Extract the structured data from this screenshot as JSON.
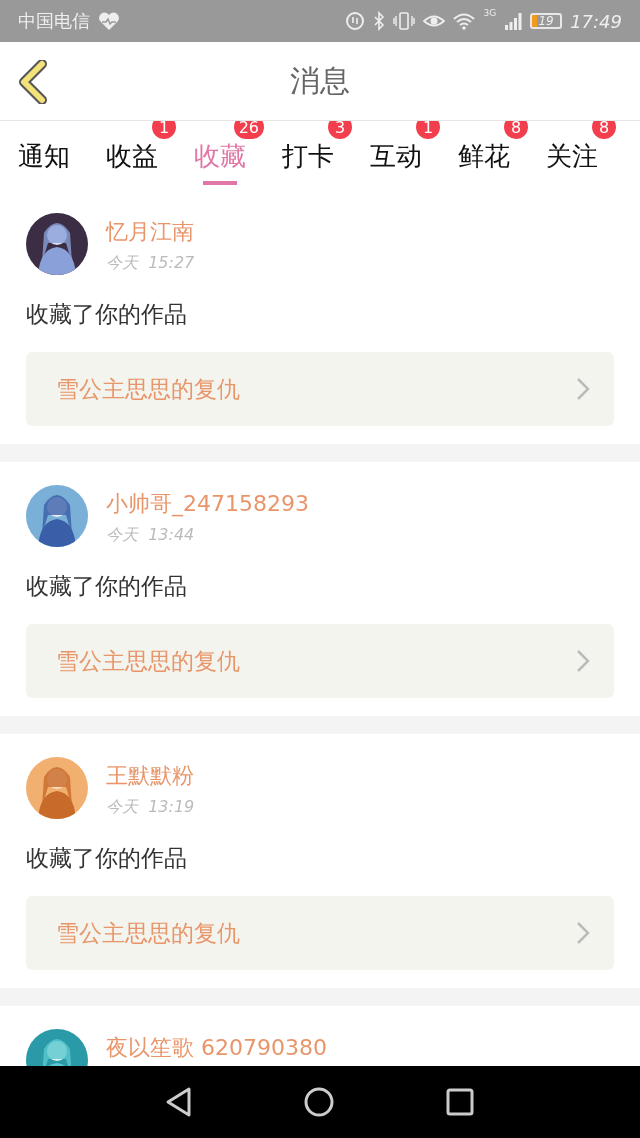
{
  "status_bar": {
    "carrier": "中国电信",
    "network": "3G",
    "battery": "19",
    "time": "17:49"
  },
  "header": {
    "title": "消息"
  },
  "tabs": [
    {
      "label": "通知",
      "selected": false
    },
    {
      "label": "收益",
      "badge": "1",
      "selected": false
    },
    {
      "label": "收藏",
      "badge": "26",
      "selected": true
    },
    {
      "label": "打卡",
      "badge": "3",
      "selected": false
    },
    {
      "label": "互动",
      "badge": "1",
      "selected": false
    },
    {
      "label": "鲜花",
      "badge": "8",
      "selected": false
    },
    {
      "label": "关注",
      "badge": "8",
      "selected": false
    }
  ],
  "messages": [
    {
      "user": "忆月江南",
      "time": "今天  15:27",
      "action": "收藏了你的作品",
      "work": "雪公主思思的复仇"
    },
    {
      "user": "小帅哥_247158293",
      "time": "今天  13:44",
      "action": "收藏了你的作品",
      "work": "雪公主思思的复仇"
    },
    {
      "user": "王默默粉",
      "time": "今天  13:19",
      "action": "收藏了你的作品",
      "work": "雪公主思思的复仇"
    },
    {
      "user": "夜以笙歌 620790380"
    }
  ]
}
